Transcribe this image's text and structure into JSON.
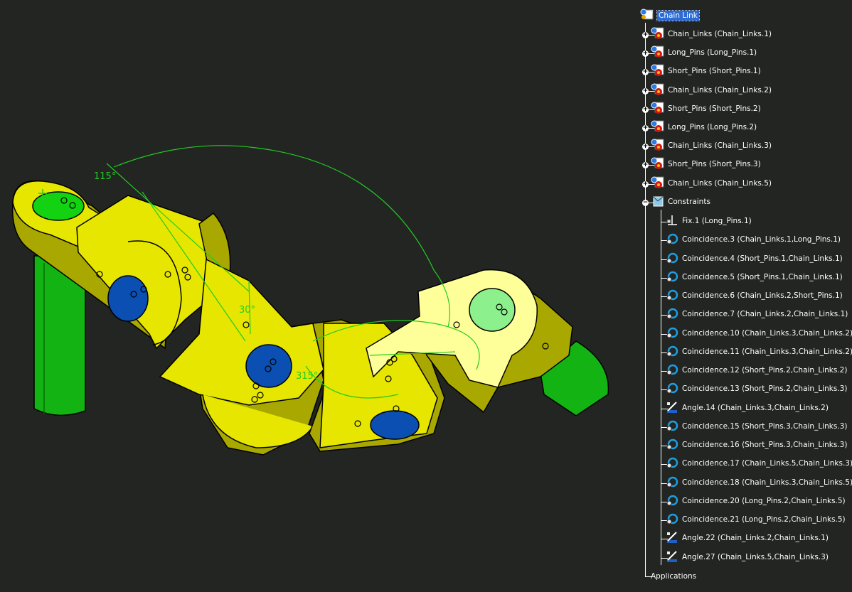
{
  "tree": {
    "root": {
      "label": "Chain Link",
      "icon": "product-icon"
    },
    "components": [
      {
        "label": "Chain_Links (Chain_Links.1)",
        "icon": "part-icon"
      },
      {
        "label": "Long_Pins (Long_Pins.1)",
        "icon": "part-icon"
      },
      {
        "label": "Short_Pins (Short_Pins.1)",
        "icon": "part-icon"
      },
      {
        "label": "Chain_Links (Chain_Links.2)",
        "icon": "part-icon"
      },
      {
        "label": "Short_Pins (Short_Pins.2)",
        "icon": "part-icon"
      },
      {
        "label": "Long_Pins (Long_Pins.2)",
        "icon": "part-icon"
      },
      {
        "label": "Chain_Links (Chain_Links.3)",
        "icon": "part-icon"
      },
      {
        "label": "Short_Pins (Short_Pins.3)",
        "icon": "part-icon"
      },
      {
        "label": "Chain_Links (Chain_Links.5)",
        "icon": "part-icon"
      }
    ],
    "constraints_label": "Constraints",
    "constraints": [
      {
        "label": "Fix.1 (Long_Pins.1)",
        "icon": "anchor-icon"
      },
      {
        "label": "Coincidence.3 (Chain_Links.1,Long_Pins.1)",
        "icon": "coincidence-icon"
      },
      {
        "label": "Coincidence.4 (Short_Pins.1,Chain_Links.1)",
        "icon": "coincidence-icon"
      },
      {
        "label": "Coincidence.5 (Short_Pins.1,Chain_Links.1)",
        "icon": "coincidence-icon"
      },
      {
        "label": "Coincidence.6 (Chain_Links.2,Short_Pins.1)",
        "icon": "coincidence-icon"
      },
      {
        "label": "Coincidence.7 (Chain_Links.2,Chain_Links.1)",
        "icon": "coincidence-icon"
      },
      {
        "label": "Coincidence.10 (Chain_Links.3,Chain_Links.2)",
        "icon": "coincidence-icon"
      },
      {
        "label": "Coincidence.11 (Chain_Links.3,Chain_Links.2)",
        "icon": "coincidence-icon"
      },
      {
        "label": "Coincidence.12 (Short_Pins.2,Chain_Links.2)",
        "icon": "coincidence-icon"
      },
      {
        "label": "Coincidence.13 (Short_Pins.2,Chain_Links.3)",
        "icon": "coincidence-icon"
      },
      {
        "label": "Angle.14 (Chain_Links.3,Chain_Links.2)",
        "icon": "angle-icon"
      },
      {
        "label": "Coincidence.15 (Short_Pins.3,Chain_Links.3)",
        "icon": "coincidence-icon"
      },
      {
        "label": "Coincidence.16 (Short_Pins.3,Chain_Links.3)",
        "icon": "coincidence-icon"
      },
      {
        "label": "Coincidence.17 (Chain_Links.5,Chain_Links.3)",
        "icon": "coincidence-icon"
      },
      {
        "label": "Coincidence.18 (Chain_Links.3,Chain_Links.5)",
        "icon": "coincidence-icon"
      },
      {
        "label": "Coincidence.20 (Long_Pins.2,Chain_Links.5)",
        "icon": "coincidence-icon"
      },
      {
        "label": "Coincidence.21 (Long_Pins.2,Chain_Links.5)",
        "icon": "coincidence-icon"
      },
      {
        "label": "Angle.22 (Chain_Links.2,Chain_Links.1)",
        "icon": "angle-icon"
      },
      {
        "label": "Angle.27 (Chain_Links.5,Chain_Links.3)",
        "icon": "angle-icon"
      }
    ],
    "applications_label": "Applications"
  },
  "viewport": {
    "angle_labels": {
      "a1": "115°",
      "a2": "30°",
      "a3": "315°"
    },
    "colors": {
      "background": "#222522",
      "link_yellow": "#e6e600",
      "link_shadow": "#a8a800",
      "link_light": "#ffff99",
      "pin_green": "#12b312",
      "hole_blue": "#0b4fb3",
      "hole_light_green": "#8cf08c",
      "constraint_green": "#22cc22"
    }
  }
}
